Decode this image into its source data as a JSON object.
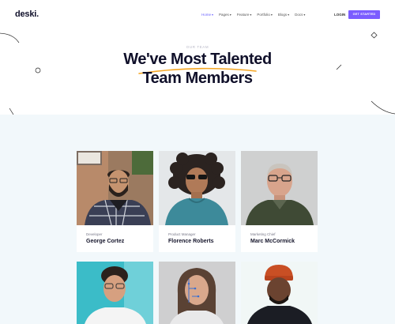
{
  "nav": {
    "logo": "deski.",
    "menu": [
      {
        "label": "Home",
        "active": true
      },
      {
        "label": "Pages",
        "active": false
      },
      {
        "label": "Feature",
        "active": false
      },
      {
        "label": "Portfolio",
        "active": false
      },
      {
        "label": "Blogs",
        "active": false
      },
      {
        "label": "Docs",
        "active": false
      }
    ],
    "login": "LOGIN",
    "cta": "GET STARTED"
  },
  "hero": {
    "eyebrow": "OUR TEAM",
    "title_line1": "We've Most Talented",
    "title_line2": "Team Members"
  },
  "team": [
    {
      "role": "Developer",
      "name": "George Cortez"
    },
    {
      "role": "Product Manager",
      "name": "Florence Roberts"
    },
    {
      "role": "Marketing Chief",
      "name": "Marc McCormick"
    },
    {
      "role": "",
      "name": ""
    },
    {
      "role": "",
      "name": ""
    },
    {
      "role": "",
      "name": ""
    }
  ],
  "colors": {
    "accent": "#6c63ff",
    "cta": "#7b5cff",
    "underline": "#f5a623",
    "section_bg": "#f2f8fb"
  }
}
